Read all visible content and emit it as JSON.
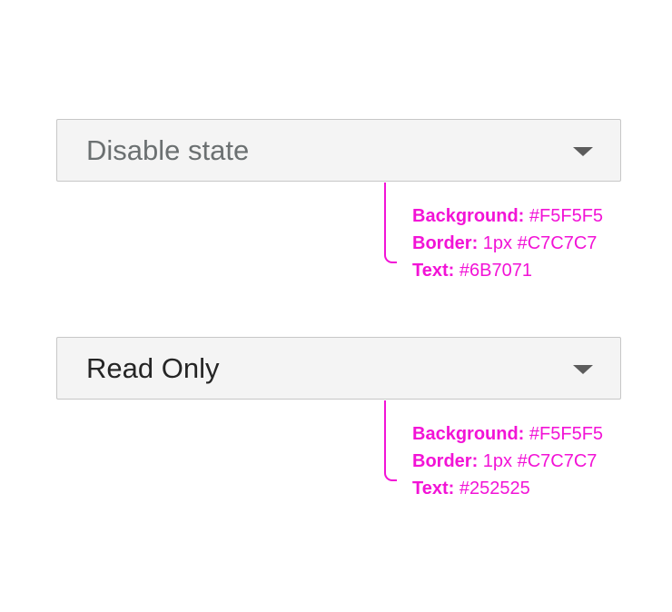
{
  "disabled_select": {
    "value": "Disable state"
  },
  "readonly_select": {
    "value": "Read Only"
  },
  "disabled_specs": [
    {
      "label": "Background:",
      "value": " #F5F5F5"
    },
    {
      "label": "Border:",
      "value": " 1px #C7C7C7"
    },
    {
      "label": "Text:",
      "value": " #6B7071"
    }
  ],
  "readonly_specs": [
    {
      "label": "Background:",
      "value": " #F5F5F5"
    },
    {
      "label": "Border:",
      "value": " 1px #C7C7C7"
    },
    {
      "label": "Text:",
      "value": " #252525"
    }
  ],
  "colors": {
    "annotation": "#F213D6",
    "field_background": "#F5F5F5",
    "field_border": "#C7C7C7",
    "disabled_text": "#6B7071",
    "readonly_text": "#252525"
  },
  "icons": {
    "dropdown": "caret-down-icon"
  }
}
